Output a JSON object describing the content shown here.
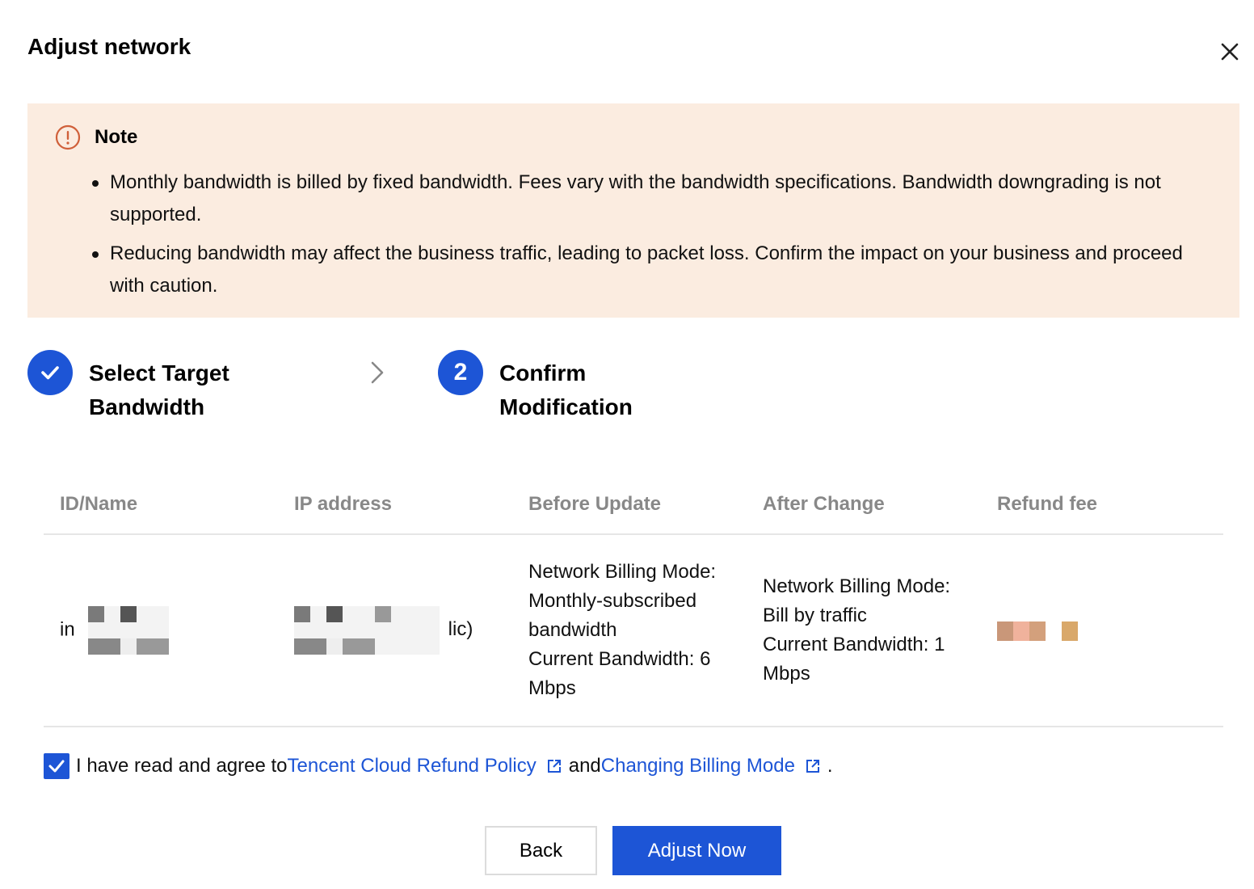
{
  "dialog": {
    "title": "Adjust network",
    "close_icon": "close-icon"
  },
  "note": {
    "title": "Note",
    "icon": "warning-circle-icon",
    "items": [
      "Monthly bandwidth is billed by fixed bandwidth. Fees vary with the bandwidth specifications. Bandwidth downgrading is not supported.",
      "Reducing bandwidth may affect the business traffic, leading to packet loss. Confirm the impact on your business and proceed with caution."
    ]
  },
  "steps": [
    {
      "label": "Select Target Bandwidth",
      "state": "done",
      "icon": "check-icon"
    },
    {
      "label": "Confirm Modification",
      "number": "2",
      "state": "active"
    }
  ],
  "table": {
    "columns": [
      "ID/Name",
      "IP address",
      "Before Update",
      "After Change",
      "Refund fee"
    ],
    "row": {
      "id_name": "in",
      "ip_address": "lic)",
      "before_update": [
        "Network Billing Mode:",
        "Monthly-subscribed",
        "bandwidth",
        "Current Bandwidth: 6",
        "Mbps"
      ],
      "after_change": [
        "Network Billing Mode:",
        "Bill by traffic",
        "Current Bandwidth: 1",
        "Mbps"
      ]
    }
  },
  "agreement": {
    "checked": true,
    "prefix": "I have read and agree to",
    "link1": "Tencent Cloud Refund Policy",
    "middle": "and",
    "link2": "Changing Billing Mode",
    "suffix": "."
  },
  "buttons": {
    "back": "Back",
    "adjust": "Adjust Now"
  },
  "colors": {
    "primary": "#1d55d6",
    "note_bg": "#fbece0",
    "note_icon": "#d0603a",
    "header_text": "#888888"
  }
}
